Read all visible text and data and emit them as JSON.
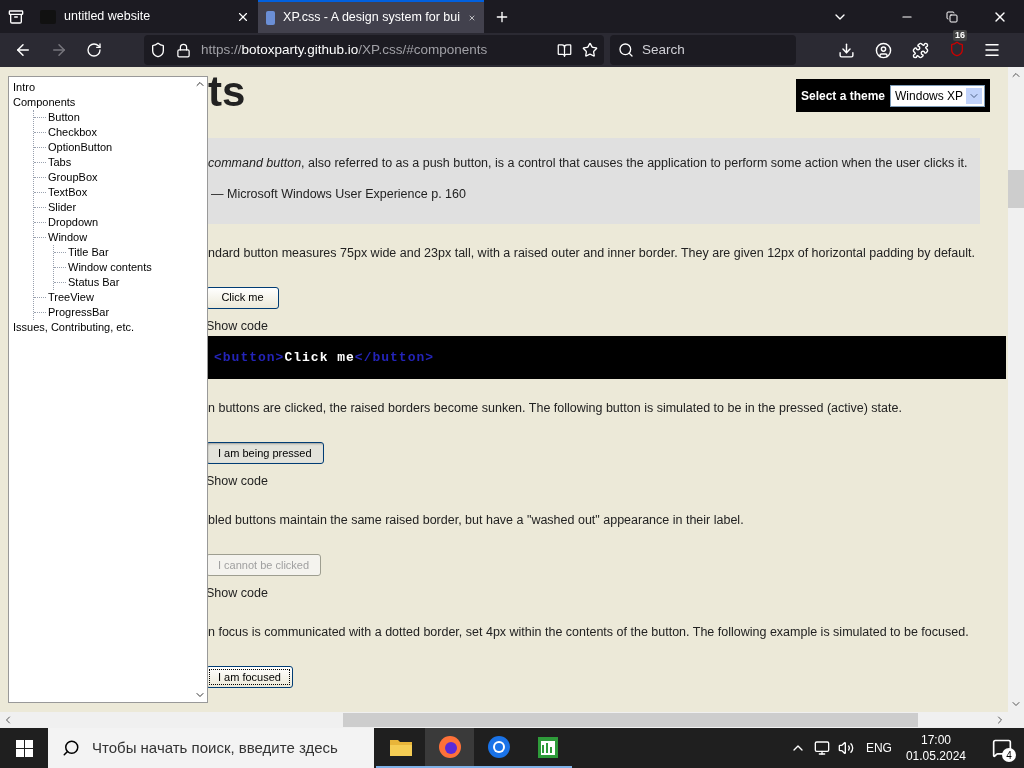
{
  "browser": {
    "tabs": [
      {
        "title": "untitled website",
        "selected": false
      },
      {
        "title": "XP.css - A design system for bui",
        "selected": true
      }
    ],
    "url": {
      "scheme": "https://",
      "host": "botoxparty.github.io",
      "path": "/XP.css/#components"
    },
    "search": {
      "placeholder": "Search"
    },
    "extension_badge": "16"
  },
  "tree": {
    "items": [
      {
        "label": "Intro"
      },
      {
        "label": "Components",
        "children": [
          {
            "label": "Button"
          },
          {
            "label": "Checkbox"
          },
          {
            "label": "OptionButton"
          },
          {
            "label": "Tabs"
          },
          {
            "label": "GroupBox"
          },
          {
            "label": "TextBox"
          },
          {
            "label": "Slider"
          },
          {
            "label": "Dropdown"
          },
          {
            "label": "Window",
            "children": [
              {
                "label": "Title Bar"
              },
              {
                "label": "Window contents"
              },
              {
                "label": "Status Bar"
              }
            ]
          },
          {
            "label": "TreeView"
          },
          {
            "label": "ProgressBar"
          }
        ]
      },
      {
        "label": "Issues, Contributing, etc."
      }
    ]
  },
  "heading": "ts",
  "theme_selector": {
    "label": "Select a theme",
    "value": "Windows XP"
  },
  "blocks": [
    {
      "kind": "quote",
      "text": "*command button*, also referred to as a push button, is a control that causes the application to perform some action when the user clicks it.",
      "cite": "— Microsoft Windows User Experience p. 160"
    },
    {
      "kind": "paragraph",
      "text": "ndard button measures 75px wide and 23px tall, with a raised outer and inner border. They are given 12px of horizontal padding by default."
    },
    {
      "kind": "button",
      "label": "Click me",
      "pressed": false,
      "disabled": false,
      "focused": false
    },
    {
      "kind": "show_code",
      "text": "Show code"
    },
    {
      "kind": "code",
      "tokens": [
        {
          "kind": "tag",
          "text": "<button>"
        },
        {
          "kind": "text",
          "text": "Click me"
        },
        {
          "kind": "tag",
          "text": "</button>"
        }
      ]
    },
    {
      "kind": "paragraph",
      "text": "n buttons are clicked, the raised borders become sunken. The following button is simulated to be in the pressed (active) state."
    },
    {
      "kind": "button",
      "label": "I am being pressed",
      "pressed": true,
      "disabled": false,
      "focused": false
    },
    {
      "kind": "show_code",
      "text": "Show code"
    },
    {
      "kind": "paragraph",
      "text": "bled buttons maintain the same raised border, but have a \"washed out\" appearance in their label."
    },
    {
      "kind": "button",
      "label": "I cannot be clicked",
      "pressed": false,
      "disabled": true,
      "focused": false
    },
    {
      "kind": "show_code",
      "text": "Show code"
    },
    {
      "kind": "paragraph",
      "text": "n focus is communicated with a dotted border, set 4px within the contents of the button. The following example is simulated to be focused."
    },
    {
      "kind": "button",
      "label": "I am focused",
      "pressed": false,
      "disabled": false,
      "focused": true
    }
  ],
  "taskbar": {
    "search_placeholder": "Чтобы начать поиск, введите здесь",
    "apps": [
      {
        "kind": "folder",
        "active": false
      },
      {
        "kind": "firefox",
        "active": true
      },
      {
        "kind": "chrome",
        "active": false
      },
      {
        "kind": "sheet",
        "active": false
      }
    ],
    "language": "ENG",
    "time": "17:00",
    "date": "01.05.2024",
    "notifications": "4"
  }
}
